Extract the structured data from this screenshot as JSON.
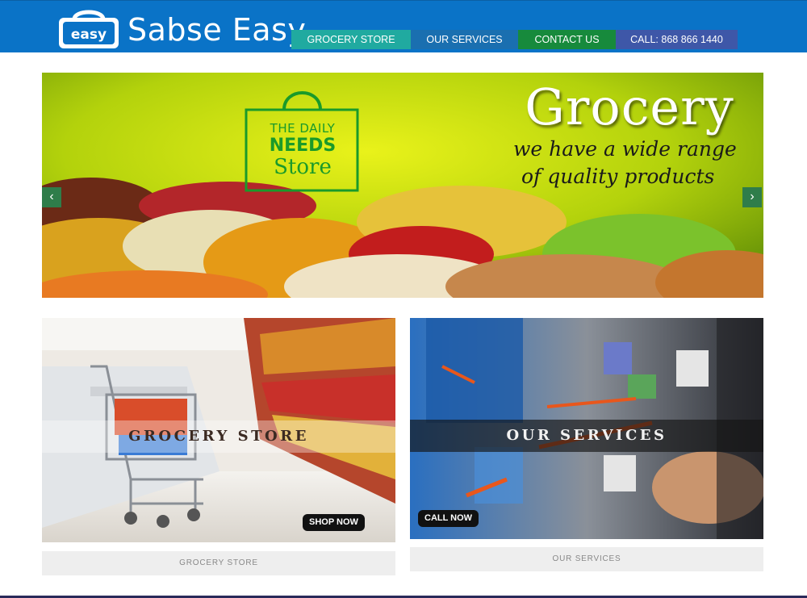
{
  "brand": {
    "logo_badge": "easy",
    "name": "Sabse Easy"
  },
  "nav": {
    "grocery": "GROCERY STORE",
    "services": "OUR SERVICES",
    "contact": "CONTACT US",
    "call": "CALL: 868 866 1440"
  },
  "slider": {
    "title": "Grocery",
    "tagline_line1": "we have a wide range",
    "tagline_line2": "of quality products",
    "store_logo_line1": "THE DAILY",
    "store_logo_line2": "NEEDS",
    "store_logo_line3": "Store",
    "prev_icon": "‹",
    "next_icon": "›"
  },
  "cards": {
    "grocery": {
      "band": "GROCERY STORE",
      "button": "SHOP NOW",
      "caption": "GROCERY STORE"
    },
    "services": {
      "band": "OUR SERVICES",
      "button": "CALL NOW",
      "caption": "OUR SERVICES"
    }
  },
  "colors": {
    "header": "#0a73c7",
    "nav_grocery": "#20aaa0",
    "nav_services": "#1a6fb0",
    "nav_contact": "#178a3c",
    "nav_call": "#3e57a8"
  }
}
